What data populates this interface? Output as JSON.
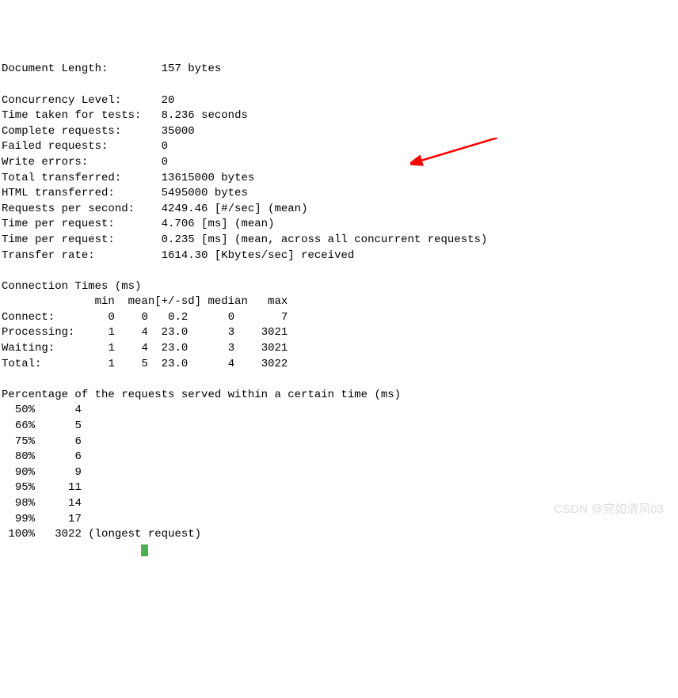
{
  "summary": {
    "document_length": {
      "label": "Document Length:",
      "value": "157 bytes"
    },
    "concurrency_level": {
      "label": "Concurrency Level:",
      "value": "20"
    },
    "time_taken": {
      "label": "Time taken for tests:",
      "value": "8.236 seconds"
    },
    "complete_requests": {
      "label": "Complete requests:",
      "value": "35000"
    },
    "failed_requests": {
      "label": "Failed requests:",
      "value": "0"
    },
    "write_errors": {
      "label": "Write errors:",
      "value": "0"
    },
    "total_transferred": {
      "label": "Total transferred:",
      "value": "13615000 bytes"
    },
    "html_transferred": {
      "label": "HTML transferred:",
      "value": "5495000 bytes"
    },
    "requests_per_second": {
      "label": "Requests per second:",
      "value": "4249.46 [#/sec] (mean)"
    },
    "time_per_request1": {
      "label": "Time per request:",
      "value": "4.706 [ms] (mean)"
    },
    "time_per_request2": {
      "label": "Time per request:",
      "value": "0.235 [ms] (mean, across all concurrent requests)"
    },
    "transfer_rate": {
      "label": "Transfer rate:",
      "value": "1614.30 [Kbytes/sec] received"
    }
  },
  "connection_times": {
    "title": "Connection Times (ms)",
    "header": "              min  mean[+/-sd] median   max",
    "rows": {
      "connect": {
        "label": "Connect:",
        "min": "0",
        "mean": "0",
        "sd": "0.2",
        "median": "0",
        "max": "7"
      },
      "processing": {
        "label": "Processing:",
        "min": "1",
        "mean": "4",
        "sd": "23.0",
        "median": "3",
        "max": "3021"
      },
      "waiting": {
        "label": "Waiting:",
        "min": "1",
        "mean": "4",
        "sd": "23.0",
        "median": "3",
        "max": "3021"
      },
      "total": {
        "label": "Total:",
        "min": "1",
        "mean": "5",
        "sd": "23.0",
        "median": "4",
        "max": "3022"
      }
    }
  },
  "percentages": {
    "title": "Percentage of the requests served within a certain time (ms)",
    "rows": [
      {
        "pct": "50%",
        "val": "4"
      },
      {
        "pct": "66%",
        "val": "5"
      },
      {
        "pct": "75%",
        "val": "6"
      },
      {
        "pct": "80%",
        "val": "6"
      },
      {
        "pct": "90%",
        "val": "9"
      },
      {
        "pct": "95%",
        "val": "11"
      },
      {
        "pct": "98%",
        "val": "14"
      },
      {
        "pct": "99%",
        "val": "17"
      },
      {
        "pct": "100%",
        "val": "3022",
        "note": "(longest request)"
      }
    ]
  },
  "watermark": "CSDN @宛如清风03"
}
